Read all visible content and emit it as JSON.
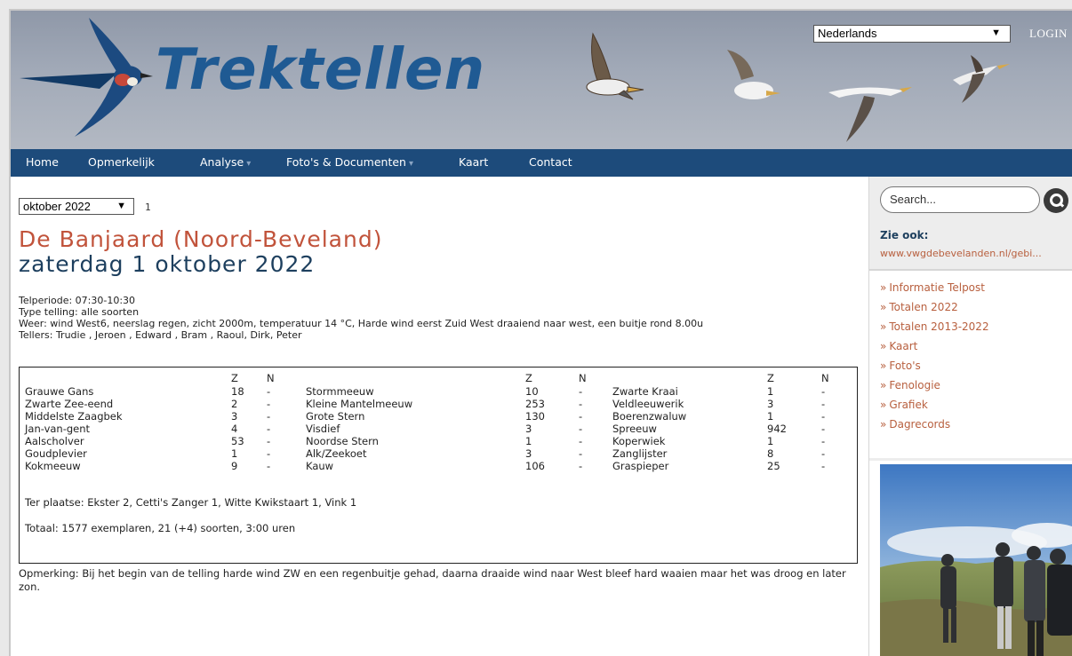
{
  "header": {
    "logo_text": "Trektellen",
    "language_selected": "Nederlands",
    "login_label": "LOGIN"
  },
  "nav": {
    "items": [
      {
        "label": "Home"
      },
      {
        "label": "Opmerkelijk"
      },
      {
        "label": "Analyse",
        "dropdown": true
      },
      {
        "label": "Foto's & Documenten",
        "dropdown": true
      },
      {
        "label": "Kaart"
      },
      {
        "label": "Contact"
      }
    ],
    "caret": "▾"
  },
  "main": {
    "month_selected": "oktober 2022",
    "page_number": "1",
    "site_title": "De Banjaard (Noord-Beveland)",
    "date_title": "zaterdag 1 oktober 2022",
    "telperiode": "Telperiode: 07:30-10:30",
    "type_telling": "Type telling: alle soorten",
    "weer": "Weer: wind West6, neerslag regen, zicht 2000m, temperatuur 14 °C, Harde wind eerst Zuid West draaiend naar west, een buitje rond 8.00u",
    "tellers": "Tellers: Trudie , Jeroen , Edward , Bram , Raoul, Dirk, Peter",
    "table": {
      "col_z": "Z",
      "col_n": "N",
      "columns": [
        [
          {
            "name": "Grauwe Gans",
            "z": "18",
            "n": "-"
          },
          {
            "name": "Zwarte Zee-eend",
            "z": "2",
            "n": "-"
          },
          {
            "name": "Middelste Zaagbek",
            "z": "3",
            "n": "-"
          },
          {
            "name": "Jan-van-gent",
            "z": "4",
            "n": "-"
          },
          {
            "name": "Aalscholver",
            "z": "53",
            "n": "-"
          },
          {
            "name": "Goudplevier",
            "z": "1",
            "n": "-"
          },
          {
            "name": "Kokmeeuw",
            "z": "9",
            "n": "-"
          }
        ],
        [
          {
            "name": "Stormmeeuw",
            "z": "10",
            "n": "-"
          },
          {
            "name": "Kleine Mantelmeeuw",
            "z": "253",
            "n": "-"
          },
          {
            "name": "Grote Stern",
            "z": "130",
            "n": "-"
          },
          {
            "name": "Visdief",
            "z": "3",
            "n": "-"
          },
          {
            "name": "Noordse Stern",
            "z": "1",
            "n": "-"
          },
          {
            "name": "Alk/Zeekoet",
            "z": "3",
            "n": "-"
          },
          {
            "name": "Kauw",
            "z": "106",
            "n": "-"
          }
        ],
        [
          {
            "name": "Zwarte Kraai",
            "z": "1",
            "n": "-"
          },
          {
            "name": "Veldleeuwerik",
            "z": "3",
            "n": "-"
          },
          {
            "name": "Boerenzwaluw",
            "z": "1",
            "n": "-"
          },
          {
            "name": "Spreeuw",
            "z": "942",
            "n": "-"
          },
          {
            "name": "Koperwiek",
            "z": "1",
            "n": "-"
          },
          {
            "name": "Zanglijster",
            "z": "8",
            "n": "-"
          },
          {
            "name": "Graspieper",
            "z": "25",
            "n": "-"
          }
        ]
      ],
      "ter_plaatse": "Ter plaatse: Ekster 2, Cetti's Zanger 1, Witte Kwikstaart 1, Vink 1",
      "totaal": "Totaal: 1577 exemplaren, 21 (+4) soorten, 3:00 uren"
    },
    "opmerking": "Opmerking: Bij het begin van de telling harde wind ZW en een regenbuitje gehad, daarna draaide wind naar West bleef hard waaien maar het was droog en later zon."
  },
  "sidebar": {
    "search_placeholder": "Search...",
    "zie_ook_label": "Zie ook:",
    "zie_ook_link": "www.vwgdebevelanden.nl/gebi...",
    "link_prefix": "»",
    "links": [
      "Informatie Telpost",
      "Totalen 2022",
      "Totalen 2013-2022",
      "Kaart",
      "Foto's",
      "Fenologie",
      "Grafiek",
      "Dagrecords"
    ]
  },
  "colors": {
    "nav_bg": "#1d4b7b",
    "logo": "#1f5a93",
    "site_title": "#c1533b",
    "date_title": "#1d3f5e",
    "link": "#b8603f"
  }
}
